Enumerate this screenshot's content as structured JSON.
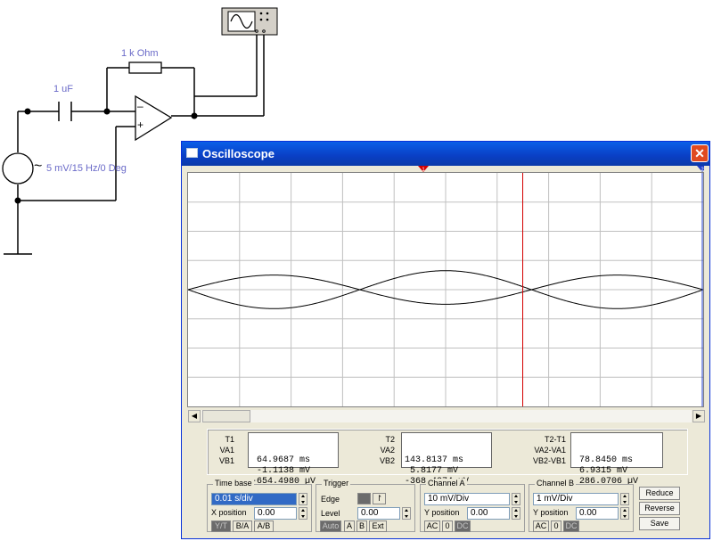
{
  "schematic": {
    "resistor_label": "1 k Ohm",
    "capacitor_label": "1 uF",
    "source_label": "5 mV/15 Hz/0 Deg",
    "opamp_minus": "–",
    "opamp_plus": "+",
    "tilde": "~"
  },
  "window": {
    "title": "Oscilloscope",
    "close_glyph": "✕",
    "cursor1_label": "1",
    "cursor2_label": "2"
  },
  "readout": {
    "col1": {
      "labels": [
        "T1",
        "VA1",
        "VB1"
      ],
      "values": [
        " 64.9687 ms",
        " -1.1138 mV",
        "-654.4980 µV"
      ]
    },
    "col2": {
      "labels": [
        "T2",
        "VA2",
        "VB2"
      ],
      "values": [
        "143.8137 ms",
        " 5.8177 mV",
        "-368.4274 µV"
      ]
    },
    "col3": {
      "labels": [
        "T2-T1",
        "VA2-VA1",
        "VB2-VB1"
      ],
      "values": [
        " 78.8450 ms",
        " 6.9315 mV",
        " 286.0706 µV"
      ]
    }
  },
  "timebase": {
    "title": "Time base",
    "value": "0.01 s/div",
    "xpos_label": "X position",
    "xpos_value": "0.00",
    "modes": [
      "Y/T",
      "B/A",
      "A/B"
    ],
    "selected_mode": "Y/T"
  },
  "trigger": {
    "title": "Trigger",
    "edge_label": "Edge",
    "edge_rise": "¬",
    "edge_fall": "¬",
    "level_label": "Level",
    "level_value": "0.00",
    "modes": [
      "Auto",
      "A",
      "B",
      "Ext"
    ]
  },
  "channel_a": {
    "title": "Channel A",
    "value": "10 mV/Div",
    "ypos_label": "Y position",
    "ypos_value": "0.00",
    "coupling": [
      "AC",
      "0",
      "DC"
    ],
    "selected": "DC"
  },
  "channel_b": {
    "title": "Channel B",
    "value": "1 mV/Div",
    "ypos_label": "Y position",
    "ypos_value": "0.00",
    "coupling": [
      "AC",
      "0",
      "DC"
    ],
    "selected": "DC"
  },
  "buttons": {
    "reduce": "Reduce",
    "reverse": "Reverse",
    "save": "Save"
  },
  "traces": {
    "color": "#000000",
    "cursor_color": "#d40000",
    "grid_color": "#c0c0c0",
    "channel_a_ampl_div": 0.5,
    "channel_b_ampl_div": 0.65,
    "frequency_hz": 15,
    "cursor1_time_ms": 64.9687,
    "cursor2_time_ms": 143.8137
  }
}
